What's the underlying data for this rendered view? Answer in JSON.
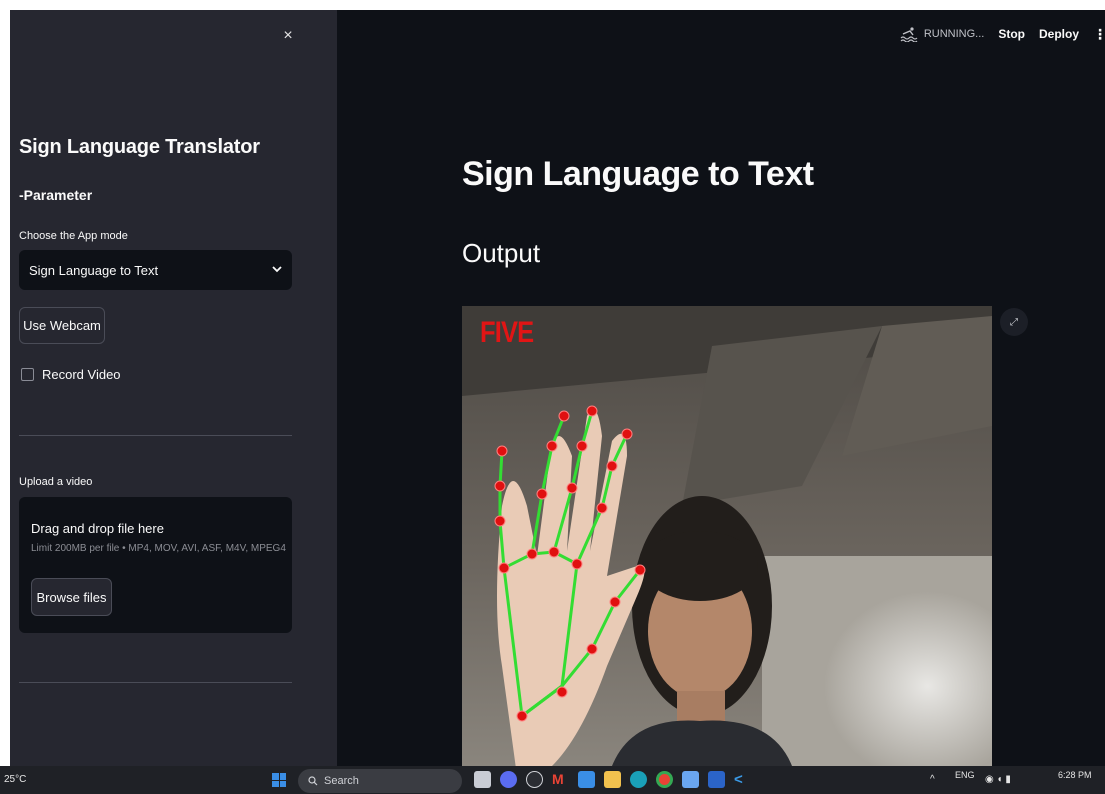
{
  "sidebar": {
    "close_glyph": "×",
    "title": "Sign Language Translator",
    "section": "-Parameter",
    "mode_label": "Choose the App mode",
    "mode_selected": "Sign Language to Text",
    "webcam_button": "Use Webcam",
    "record_label": "Record Video",
    "record_checked": false,
    "upload_label": "Upload a video",
    "dropzone_title": "Drag and drop file here",
    "dropzone_limit": "Limit 200MB per file • MP4, MOV, AVI, ASF, M4V, MPEG4",
    "browse_button": "Browse files"
  },
  "topbar": {
    "status": "RUNNING...",
    "stop": "Stop",
    "deploy": "Deploy",
    "menu_glyph": "⋮"
  },
  "main": {
    "title": "Sign Language to Text",
    "output_heading": "Output",
    "prediction": "FIVE",
    "expand_glyph": "⤢"
  },
  "taskbar": {
    "temperature": "25°C",
    "search_placeholder": "Search",
    "language": "ENG",
    "time": "6:28 PM",
    "tray_up": "^"
  },
  "colors": {
    "app_bg": "#0e1117",
    "sidebar_bg": "#262730",
    "prediction_red": "#e11515",
    "landmark_line": "#33dd33",
    "landmark_dot": "#e01010"
  },
  "icons": {
    "taskbar_apps": [
      "start-icon",
      "search-icon",
      "file-explorer-icon",
      "copilot-icon",
      "dell-icon",
      "gmail-icon",
      "store-icon",
      "folder-icon",
      "edge-icon",
      "chrome-icon",
      "notepad-icon",
      "word-icon",
      "vscode-icon"
    ]
  }
}
